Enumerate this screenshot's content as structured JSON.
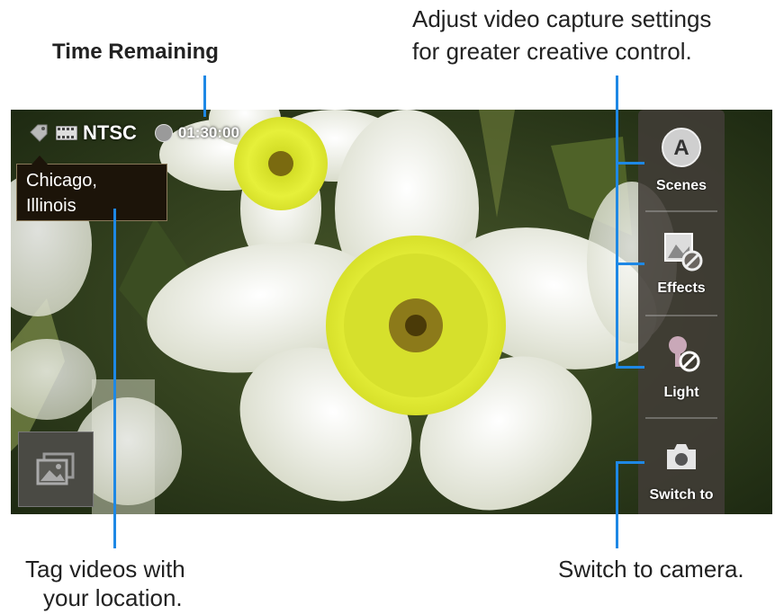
{
  "callouts": {
    "time_remaining": "Time Remaining",
    "settings_line1": "Adjust video capture settings",
    "settings_line2": "for greater creative control.",
    "location_line1": "Tag videos with",
    "location_line2": "your location.",
    "switch": "Switch to camera."
  },
  "camera": {
    "status": {
      "tag_icon": "location-tag-icon",
      "format_icon": "film-icon",
      "format": "NTSC",
      "record_icon": "record-dot-icon",
      "timer": "01:30:00"
    },
    "location": {
      "line1": "Chicago,",
      "line2": "Illinois"
    },
    "gallery_icon": "gallery-icon",
    "side_panel": [
      {
        "label": "Scenes",
        "icon": "scenes-auto-icon",
        "icon_letter": "A"
      },
      {
        "label": "Effects",
        "icon": "effects-off-icon"
      },
      {
        "label": "Light",
        "icon": "light-off-icon"
      },
      {
        "label": "Switch to",
        "icon": "camera-icon"
      }
    ]
  },
  "colors": {
    "leader": "#1e88e5",
    "panel": "#413c37",
    "location_bg": "#1c1409"
  }
}
